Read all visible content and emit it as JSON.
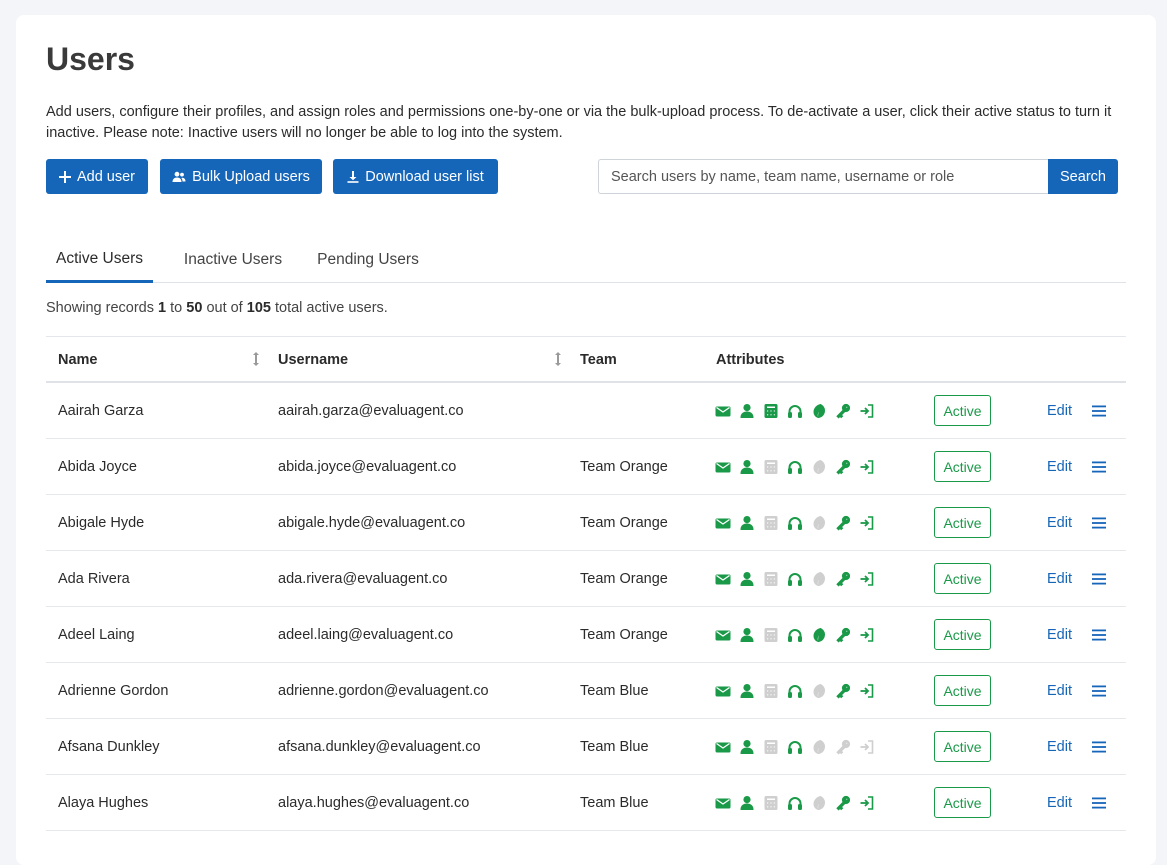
{
  "page": {
    "title": "Users",
    "description": "Add users, configure their profiles, and assign roles and permissions one-by-one or via the bulk-upload process. To de-activate a user, click their active status to turn it inactive. Please note: Inactive users will no longer be able to log into the system."
  },
  "toolbar": {
    "add_label": "Add user",
    "bulk_label": "Bulk Upload users",
    "download_label": "Download user list",
    "search_placeholder": "Search users by name, team name, username or role",
    "search_button": "Search"
  },
  "tabs": [
    {
      "label": "Active Users",
      "active": true
    },
    {
      "label": "Inactive Users",
      "active": false
    },
    {
      "label": "Pending Users",
      "active": false
    }
  ],
  "summary": {
    "prefix": "Showing records",
    "from": "1",
    "to_word": "to",
    "to": "50",
    "out_of": "out of",
    "total": "105",
    "suffix": "total active users."
  },
  "table": {
    "headers": {
      "name": "Name",
      "username": "Username",
      "team": "Team",
      "attributes": "Attributes"
    },
    "edit_label": "Edit",
    "colors": {
      "on": "#1a9a48",
      "off": "#cfcfcf",
      "link": "#1565b8"
    },
    "attribute_icons": [
      "envelope-icon",
      "person-icon",
      "calculator-icon",
      "headset-icon",
      "leaf-icon",
      "key-icon",
      "sign-in-icon"
    ],
    "rows": [
      {
        "name": "Aairah Garza",
        "username": "aairah.garza@evaluagent.co",
        "team": "",
        "status": "Active",
        "attrs": [
          1,
          1,
          1,
          1,
          1,
          1,
          1
        ]
      },
      {
        "name": "Abida Joyce",
        "username": "abida.joyce@evaluagent.co",
        "team": "Team Orange",
        "status": "Active",
        "attrs": [
          1,
          1,
          0,
          1,
          0,
          1,
          1
        ]
      },
      {
        "name": "Abigale Hyde",
        "username": "abigale.hyde@evaluagent.co",
        "team": "Team Orange",
        "status": "Active",
        "attrs": [
          1,
          1,
          0,
          1,
          0,
          1,
          1
        ]
      },
      {
        "name": "Ada Rivera",
        "username": "ada.rivera@evaluagent.co",
        "team": "Team Orange",
        "status": "Active",
        "attrs": [
          1,
          1,
          0,
          1,
          0,
          1,
          1
        ]
      },
      {
        "name": "Adeel Laing",
        "username": "adeel.laing@evaluagent.co",
        "team": "Team Orange",
        "status": "Active",
        "attrs": [
          1,
          1,
          0,
          1,
          1,
          1,
          1
        ]
      },
      {
        "name": "Adrienne Gordon",
        "username": "adrienne.gordon@evaluagent.co",
        "team": "Team Blue",
        "status": "Active",
        "attrs": [
          1,
          1,
          0,
          1,
          0,
          1,
          1
        ]
      },
      {
        "name": "Afsana Dunkley",
        "username": "afsana.dunkley@evaluagent.co",
        "team": "Team Blue",
        "status": "Active",
        "attrs": [
          1,
          1,
          0,
          1,
          0,
          0,
          0
        ]
      },
      {
        "name": "Alaya Hughes",
        "username": "alaya.hughes@evaluagent.co",
        "team": "Team Blue",
        "status": "Active",
        "attrs": [
          1,
          1,
          0,
          1,
          0,
          1,
          1
        ]
      }
    ]
  }
}
